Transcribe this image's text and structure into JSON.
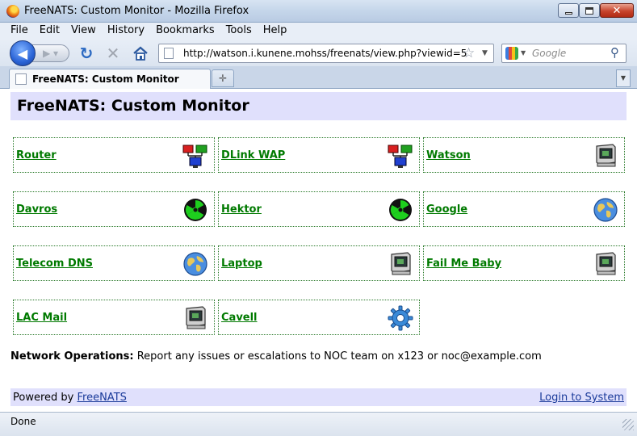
{
  "window": {
    "title": "FreeNATS: Custom Monitor - Mozilla Firefox"
  },
  "menu": [
    "File",
    "Edit",
    "View",
    "History",
    "Bookmarks",
    "Tools",
    "Help"
  ],
  "nav": {
    "url": "http://watson.i.kunene.mohss/freenats/view.php?viewid=5",
    "search_placeholder": "Google"
  },
  "tabs": [
    {
      "label": "FreeNATS: Custom Monitor"
    }
  ],
  "page": {
    "title": "FreeNATS: Custom Monitor",
    "tiles": [
      {
        "label": "Router",
        "icon": "network-icon"
      },
      {
        "label": "DLink WAP",
        "icon": "network-icon"
      },
      {
        "label": "Watson",
        "icon": "computer-icon"
      },
      {
        "label": "Davros",
        "icon": "radiation-icon"
      },
      {
        "label": "Hektor",
        "icon": "radiation-icon"
      },
      {
        "label": "Google",
        "icon": "globe-icon"
      },
      {
        "label": "Telecom DNS",
        "icon": "globe-icon"
      },
      {
        "label": "Laptop",
        "icon": "computer-icon"
      },
      {
        "label": "Fail Me Baby",
        "icon": "computer-icon"
      },
      {
        "label": "LAC Mail",
        "icon": "computer-icon"
      },
      {
        "label": "Cavell",
        "icon": "gear-icon"
      }
    ],
    "ops_label": "Network Operations:",
    "ops_text": "Report any issues or escalations to NOC team on x123 or noc@example.com",
    "footer": {
      "powered_prefix": "Powered by",
      "powered_link": "FreeNATS",
      "login": "Login to System"
    }
  },
  "status": "Done",
  "colors": {
    "header_bg": "#e0e0fc",
    "tile_link": "#007a00",
    "tile_border": "#2a7a2a",
    "footer_link": "#1a3a9a"
  }
}
